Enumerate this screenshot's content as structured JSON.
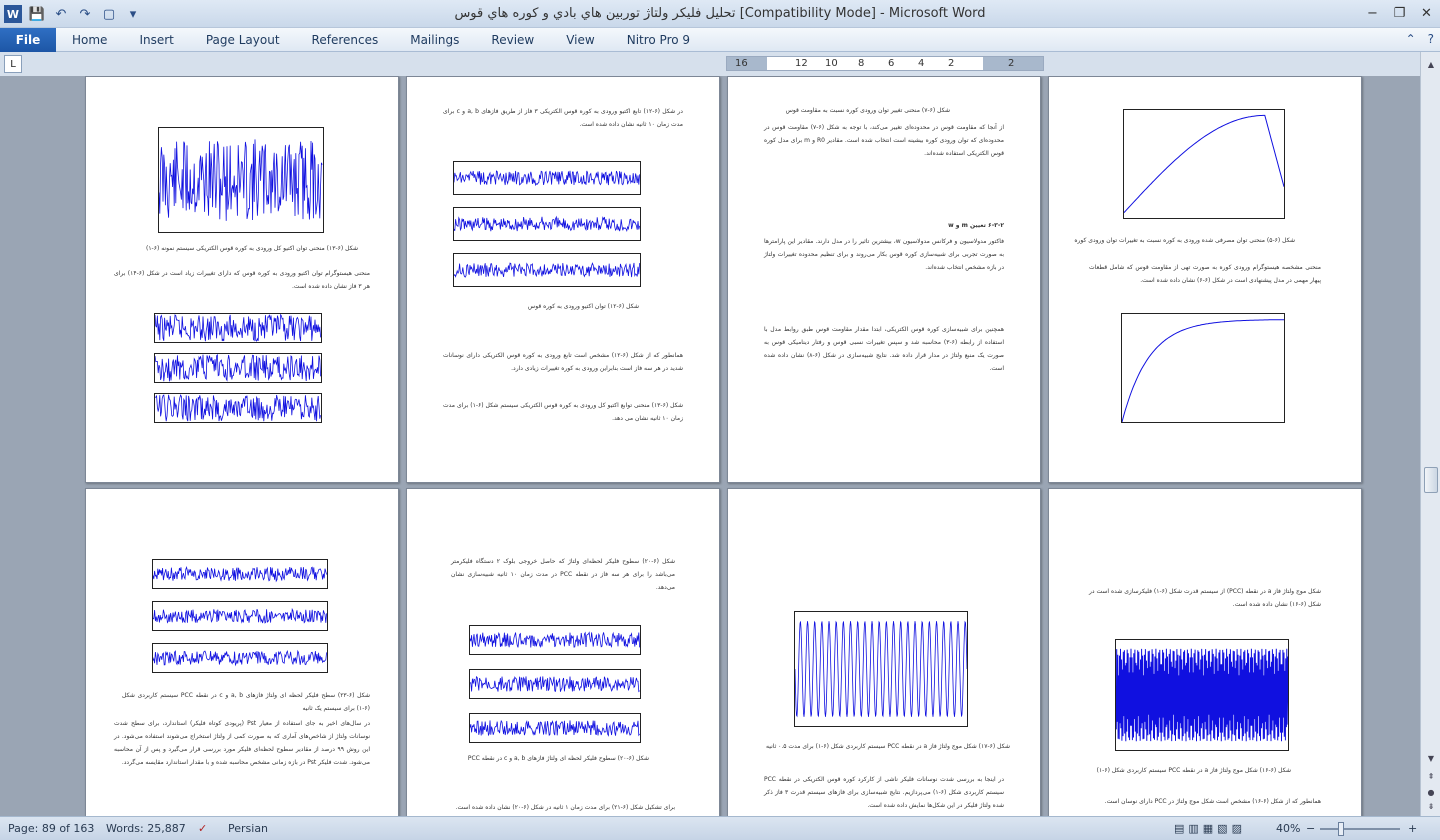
{
  "window": {
    "title": "تحليل فليکر ولتاژ توربين هاي بادي و کوره هاي قوس [Compatibility Mode]  -  Microsoft Word",
    "minimize": "−",
    "restore": "❐",
    "close": "✕"
  },
  "qat": {
    "word_icon": "W",
    "save_icon": "💾",
    "undo_icon": "↶",
    "redo_icon": "↷",
    "new_icon": "▢",
    "customize_icon": "▾"
  },
  "ribbon": {
    "file": "File",
    "tabs": [
      "Home",
      "Insert",
      "Page Layout",
      "References",
      "Mailings",
      "Review",
      "View",
      "Nitro Pro 9"
    ],
    "help_icon": "?",
    "minimize_ribbon_icon": "⌃"
  },
  "ruler": {
    "tab_selector": "L",
    "ticks": [
      "16",
      "12",
      "10",
      "8",
      "6",
      "4",
      "2",
      "",
      "2"
    ]
  },
  "status": {
    "page": "Page: 89 of 163",
    "words": "Words: 25,887",
    "language": "Persian",
    "zoom": "40%",
    "zoom_minus": "−",
    "zoom_plus": "+",
    "proofing_icon": "✓"
  },
  "pages": {
    "p1": {
      "caption1": "شکل (۶-۱۳) منحنی توان اکتیو کل ورودی به کوره قوس الکتریکی سیستم نمونه (۶-۱)",
      "body1": "منحنی هیستوگرام توان اکتیو ورودی به کوره قوس که دارای تغییرات زیاد است در شکل (۶-۱۴) برای هر ۳ فاز نشان داده شده است."
    },
    "p2": {
      "body1": "در شکل (۶-۱۲) تابع اکتیو ورودی به کوره قوس الکتریکی ۳ فاز از طریق فازهای a, b و c برای مدت زمان ۱۰ ثانیه نشان داده شده است.",
      "caption1": "شکل (۶-۱۲) توان اکتیو ورودی به کوره قوس",
      "body2": "همانطور که از شکل (۶-۱۲) مشخص است تابع ورودی به کوره قوس الکتریکی دارای نوسانات شدید در هر سه فاز است بنابراین ورودی به کوره تغییرات زیادی دارد.",
      "body3": "شکل (۶-۱۳) منحنی توابع اکتیو کل ورودی به کوره قوس الکتریکی سیستم شکل (۶-۱) برای مدت زمان ۱۰ ثانیه نشان می دهد."
    },
    "p3": {
      "caption1": "شکل (۶-۷) منحنی تغییر توان ورودی کوره نسبت به مقاومت قوس",
      "body1": "از آنجا که مقاومت قوس در محدوده‌ای تغییر می‌کند، با توجه به شکل (۶-۷) مقاومت قوس در محدوده‌ای که توان ورودی کوره بیشینه است انتخاب شده است. مقادیر R0 و m برای مدل کوره قوس الکتریکی استفاده شده‌اند.",
      "heading": "۶-۳-۲ تعیین m و w",
      "body2": "فاکتور مدولاسیون و فرکانس مدولاسیون w، بیشترین تاثیر را در مدل دارند. مقادیر این پارامترها به صورت تجربی برای شبیه‌سازی کوره قوس بکار می‌روند و برای تنظیم محدوده تغییرات ولتاژ در بازه مشخص انتخاب شده‌اند.",
      "body3": "همچنین برای شبیه‌سازی کوره قوس الکتریکی، ابتدا مقدار مقاومت قوس طبق روابط مدل با استفاده از رابطه (۶-۳) محاسبه شد و سپس تغییرات نسبی قوس و رفتار دینامیکی قوس به صورت یک منبع ولتاژ در مدار قرار داده شد. نتایج شبیه‌سازی در شکل (۶-۸) نشان داده شده است."
    },
    "p4": {
      "caption1": "شکل (۶-۵) منحنی توان مصرفی شده ورودی به کوره نسبت به تغییرات توان ورودی کوره",
      "body1": "منحنی مشخصه هیستوگرام ورودی کوره به صورت تهی از مقاومت قوس که شامل قطعات پیهار مهمی در مدل پیشنهادی است در شکل (۶-۶) نشان داده شده است."
    },
    "p5": {
      "caption1": "شکل (۶-۲۳) سطح فلیکر لحظه ای ولتاژ فازهای a, b و c در نقطه PCC سیستم کاربردی شکل (۶-۱) برای سیستم یک ثانیه",
      "body1": "در سال‌های اخیر به جای استفاده از معیار Pst (پریودی کوتاه فلیکر) استاندارد، برای سطح شدت نوسانات ولتاژ از شاخص‌های آماری که به صورت کمی از ولتاژ استخراج می‌شوند استفاده می‌شود. در این روش ۹۹ درصد از مقادیر سطوح لحظه‌ای فلیکر مورد بررسی قرار می‌گیرد و پس از آن محاسبه می‌شود. شدت فلیکر Pst در بازه زمانی مشخص محاسبه شده و با مقدار استاندارد مقایسه می‌گردد."
    },
    "p6": {
      "body1": "شکل (۶-۲۰) سطوح فلیکر لحظه‌ای ولتاژ که حاصل خروجی بلوک ۲ دستگاه فلیکرمتر می‌باشد را برای هر سه فاز در نقطه PCC در مدت زمان ۱۰ ثانیه شبیه‌سازی نشان می‌دهد.",
      "caption1": "شکل (۶-۲۰) سطوح فلیکر لحظه ای ولتاژ فازهای a, b و c در نقطه PCC",
      "body2": "برای تشکیل شکل (۶-۲۱) برای مدت زمان ۱ ثانیه در شکل (۶-۲۰) نشان داده شده است."
    },
    "p7": {
      "caption1": "شکل (۶-۱۷) شکل موج ولتاژ فاز a در نقطه PCC سیستم کاربردی شکل (۶-۱) برای مدت ۰.۵ ثانیه",
      "body1": "در اینجا به بررسی شدت نوسانات فلیکر ناشی از کارکرد کوره قوس الکتریکی در نقطه PCC سیستم کاربردی شکل (۶-۱) می‌پردازیم. نتایج شبیه‌سازی برای فازهای سیستم قدرت ۳ فاز ذکر شده ولتاژ فلیکر در این شکل‌ها نمایش داده شده است."
    },
    "p8": {
      "caption1": "شکل موج ولتاژ فاز a در نقطه (PCC) از سیستم قدرت شکل (۶-۱) فلیکرسازی شده است در شکل (۶-۱۶) نشان داده شده است.",
      "caption2": "شکل (۶-۱۶) شکل موج ولتاژ فاز a در نقطه PCC سیستم کاربردی شکل (۶-۱)",
      "body1": "همانطور که از شکل (۶-۱۶) مشخص است شکل موج ولتاژ در PCC دارای نوسان است."
    }
  }
}
